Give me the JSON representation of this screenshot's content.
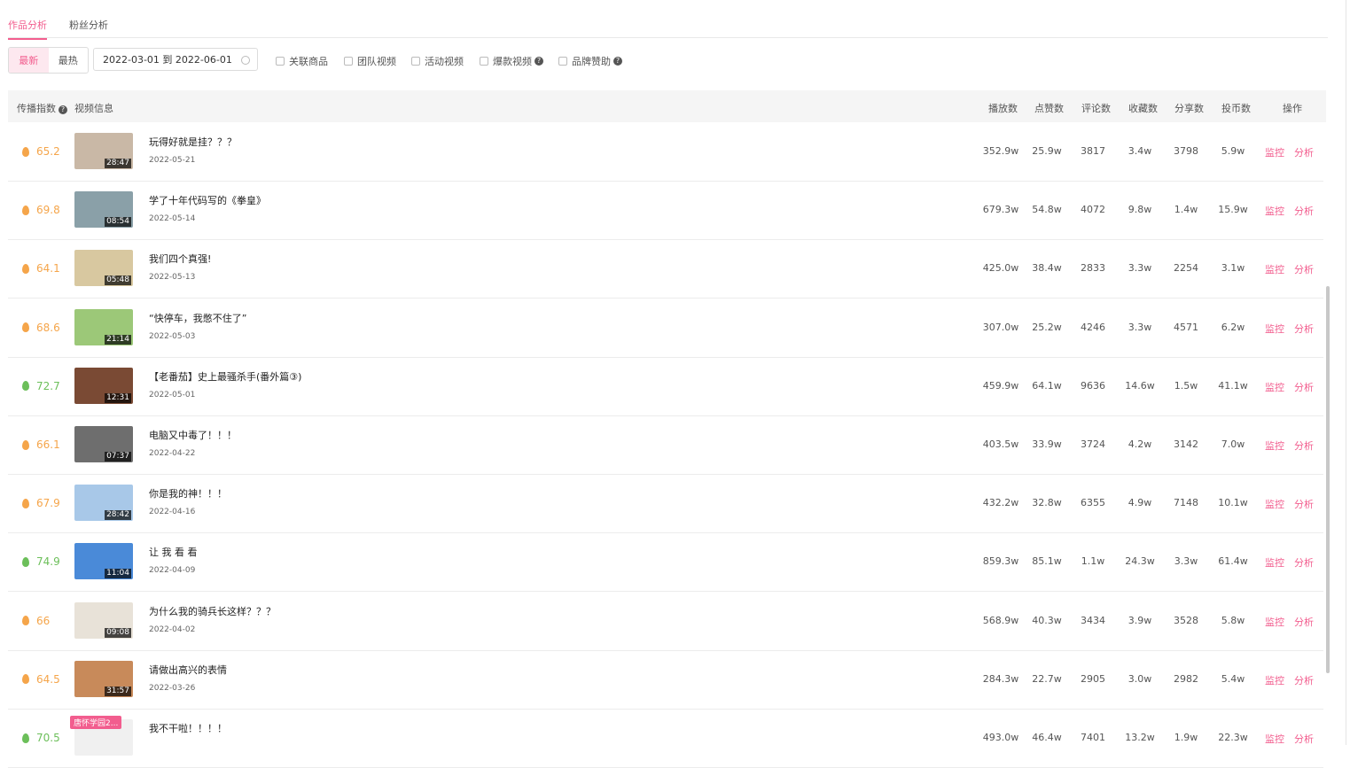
{
  "tabs": [
    {
      "label": "作品分析",
      "active": true
    },
    {
      "label": "粉丝分析",
      "active": false
    }
  ],
  "filters": {
    "sort": [
      {
        "label": "最新",
        "active": true
      },
      {
        "label": "最热",
        "active": false
      }
    ],
    "date_range": "2022-03-01 到 2022-06-01",
    "checkboxes": [
      {
        "label": "关联商品",
        "help": false
      },
      {
        "label": "团队视频",
        "help": false
      },
      {
        "label": "活动视频",
        "help": false
      },
      {
        "label": "爆款视频",
        "help": true
      },
      {
        "label": "品牌赞助",
        "help": true
      }
    ]
  },
  "table": {
    "headers": {
      "score": "传播指数",
      "info": "视频信息",
      "plays": "播放数",
      "likes": "点赞数",
      "comments": "评论数",
      "favorites": "收藏数",
      "shares": "分享数",
      "coins": "投币数",
      "actions": "操作"
    },
    "action_labels": {
      "monitor": "监控",
      "analyze": "分析"
    },
    "rows": [
      {
        "score": "65.2",
        "level": "orange",
        "duration": "28:47",
        "title": "玩得好就是挂？？？",
        "date": "2022-05-21",
        "plays": "352.9w",
        "likes": "25.9w",
        "comments": "3817",
        "favorites": "3.4w",
        "shares": "3798",
        "coins": "5.9w",
        "thumb_color": "#c9b8a6"
      },
      {
        "score": "69.8",
        "level": "orange",
        "duration": "08:54",
        "title": "学了十年代码写的《拳皇》",
        "date": "2022-05-14",
        "plays": "679.3w",
        "likes": "54.8w",
        "comments": "4072",
        "favorites": "9.8w",
        "shares": "1.4w",
        "coins": "15.9w",
        "thumb_color": "#8aa0a8"
      },
      {
        "score": "64.1",
        "level": "orange",
        "duration": "05:48",
        "title": "我们四个真强!",
        "date": "2022-05-13",
        "plays": "425.0w",
        "likes": "38.4w",
        "comments": "2833",
        "favorites": "3.3w",
        "shares": "2254",
        "coins": "3.1w",
        "thumb_color": "#d8c8a0"
      },
      {
        "score": "68.6",
        "level": "orange",
        "duration": "21:14",
        "title": "“快停车，我憋不住了”",
        "date": "2022-05-03",
        "plays": "307.0w",
        "likes": "25.2w",
        "comments": "4246",
        "favorites": "3.3w",
        "shares": "4571",
        "coins": "6.2w",
        "thumb_color": "#9cc878"
      },
      {
        "score": "72.7",
        "level": "green",
        "duration": "12:31",
        "title": "【老番茄】史上最骚杀手(番外篇③)",
        "date": "2022-05-01",
        "plays": "459.9w",
        "likes": "64.1w",
        "comments": "9636",
        "favorites": "14.6w",
        "shares": "1.5w",
        "coins": "41.1w",
        "thumb_color": "#7a4a34"
      },
      {
        "score": "66.1",
        "level": "orange",
        "duration": "07:37",
        "title": "电脑又中毒了！！！",
        "date": "2022-04-22",
        "plays": "403.5w",
        "likes": "33.9w",
        "comments": "3724",
        "favorites": "4.2w",
        "shares": "3142",
        "coins": "7.0w",
        "thumb_color": "#6e6e6e"
      },
      {
        "score": "67.9",
        "level": "orange",
        "duration": "28:42",
        "title": "你是我的神！！！",
        "date": "2022-04-16",
        "plays": "432.2w",
        "likes": "32.8w",
        "comments": "6355",
        "favorites": "4.9w",
        "shares": "7148",
        "coins": "10.1w",
        "thumb_color": "#a8c8e8"
      },
      {
        "score": "74.9",
        "level": "green",
        "duration": "11:04",
        "title": "让 我 看 看",
        "date": "2022-04-09",
        "plays": "859.3w",
        "likes": "85.1w",
        "comments": "1.1w",
        "favorites": "24.3w",
        "shares": "3.3w",
        "coins": "61.4w",
        "thumb_color": "#4a8ad8"
      },
      {
        "score": "66",
        "level": "orange",
        "duration": "09:08",
        "title": "为什么我的骑兵长这样？？？",
        "date": "2022-04-02",
        "plays": "568.9w",
        "likes": "40.3w",
        "comments": "3434",
        "favorites": "3.9w",
        "shares": "3528",
        "coins": "5.8w",
        "thumb_color": "#e8e2d8"
      },
      {
        "score": "64.5",
        "level": "orange",
        "duration": "31:57",
        "title": "请做出高兴的表情",
        "date": "2022-03-26",
        "plays": "284.3w",
        "likes": "22.7w",
        "comments": "2905",
        "favorites": "3.0w",
        "shares": "2982",
        "coins": "5.4w",
        "thumb_color": "#c88a5a"
      },
      {
        "score": "70.5",
        "level": "green",
        "duration": "",
        "badge": "唐怀学园2...",
        "title": "我不干啦！！！！",
        "date": "",
        "plays": "493.0w",
        "likes": "46.4w",
        "comments": "7401",
        "favorites": "13.2w",
        "shares": "1.9w",
        "coins": "22.3w",
        "thumb_color": "#f0f0f0"
      }
    ]
  }
}
